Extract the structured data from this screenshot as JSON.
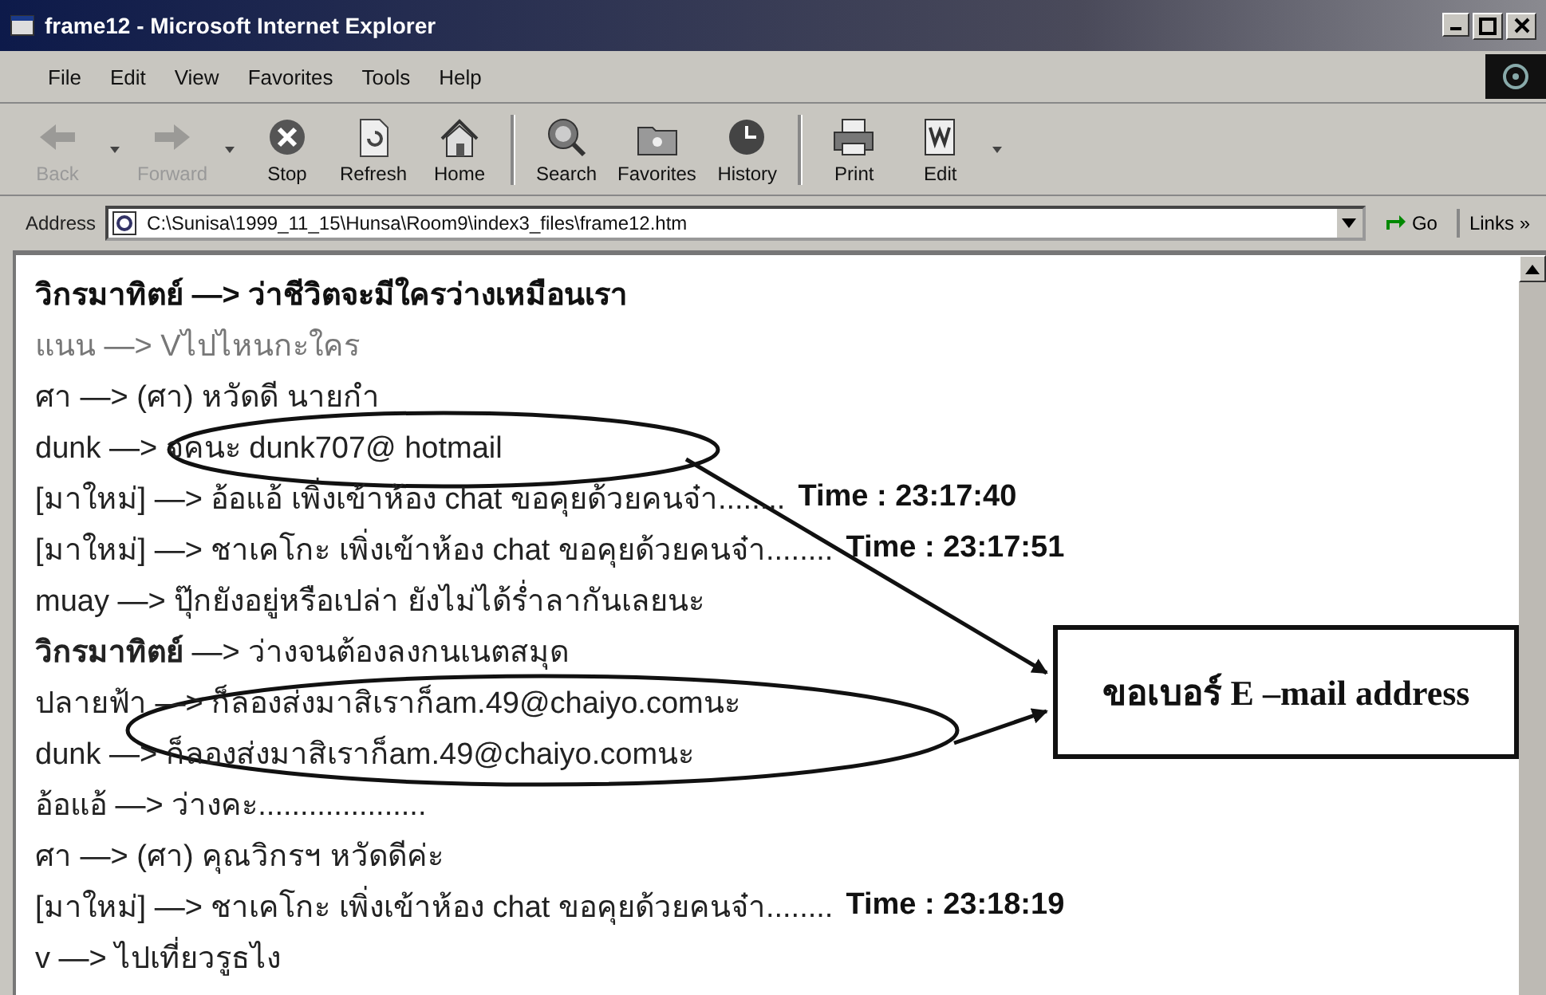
{
  "window": {
    "title": "frame12 - Microsoft Internet Explorer"
  },
  "menu": [
    "File",
    "Edit",
    "View",
    "Favorites",
    "Tools",
    "Help"
  ],
  "toolbar": [
    {
      "label": "Back",
      "disabled": true
    },
    {
      "label": "Forward",
      "disabled": true
    },
    {
      "label": "Stop",
      "disabled": false
    },
    {
      "label": "Refresh",
      "disabled": false
    },
    {
      "label": "Home",
      "disabled": false
    },
    {
      "label": "Search",
      "disabled": false
    },
    {
      "label": "Favorites",
      "disabled": false
    },
    {
      "label": "History",
      "disabled": false
    },
    {
      "label": "Print",
      "disabled": false
    },
    {
      "label": "Edit",
      "disabled": false
    }
  ],
  "address_bar": {
    "label": "Address",
    "value": "C:\\Sunisa\\1999_11_15\\Hunsa\\Room9\\index3_files\\frame12.htm",
    "go": "Go",
    "links": "Links »"
  },
  "chat": [
    {
      "text": "วิกรมาทิตย์ —> ว่าชีวิตจะมีใครว่างเหมือนเรา",
      "kind": "emphasis"
    },
    {
      "text": "แนน —> Vไปไหนกะใคร",
      "kind": "faded"
    },
    {
      "text": "ศา —> (ศา) หวัดดี นายกำ",
      "kind": "plain"
    },
    {
      "text": "dunk —> จคนะ dunk707@ hotmail",
      "kind": "plain"
    },
    {
      "text": "[มาใหม่] —> อ้อแอ้ เพิ่งเข้าห้อง chat ขอคุยด้วยคนจ๋า........",
      "time": "Time : 23:17:40",
      "kind": "plain"
    },
    {
      "text": "[มาใหม่] —> ชาเคโกะ เพิ่งเข้าห้อง chat ขอคุยด้วยคนจ๋า........",
      "time": "Time : 23:17:51",
      "kind": "plain"
    },
    {
      "text": "muay —> ปุ๊กยังอยู่หรือเปล่า ยังไม่ได้ร่ำลากันเลยนะ",
      "kind": "plain"
    },
    {
      "text": "**วิกรมาทิตย์** —> ว่างจนต้องลงกนเนตสมุด",
      "kind": "plain"
    },
    {
      "text": "ปลายฟ้า —> ก็ลองส่งมาสิเราก็am.49@chaiyo.comนะ",
      "kind": "plain"
    },
    {
      "text": "dunk —> ก็ลองส่งมาสิเราก็am.49@chaiyo.comนะ",
      "kind": "plain"
    },
    {
      "text": "อ้อแอ้ —> ว่างคะ....................",
      "kind": "plain"
    },
    {
      "text": "ศา —> (ศา) คุณวิกรฯ หวัดดีค่ะ",
      "kind": "plain"
    },
    {
      "text": "[มาใหม่] —> ชาเคโกะ เพิ่งเข้าห้อง chat ขอคุยด้วยคนจ๋า........",
      "time": "Time : 23:18:19",
      "kind": "plain"
    },
    {
      "text": "v —> ไปเที่ยวรูธไง",
      "kind": "plain"
    }
  ],
  "annotation": {
    "text": "ขอเบอร์ E –mail address"
  }
}
